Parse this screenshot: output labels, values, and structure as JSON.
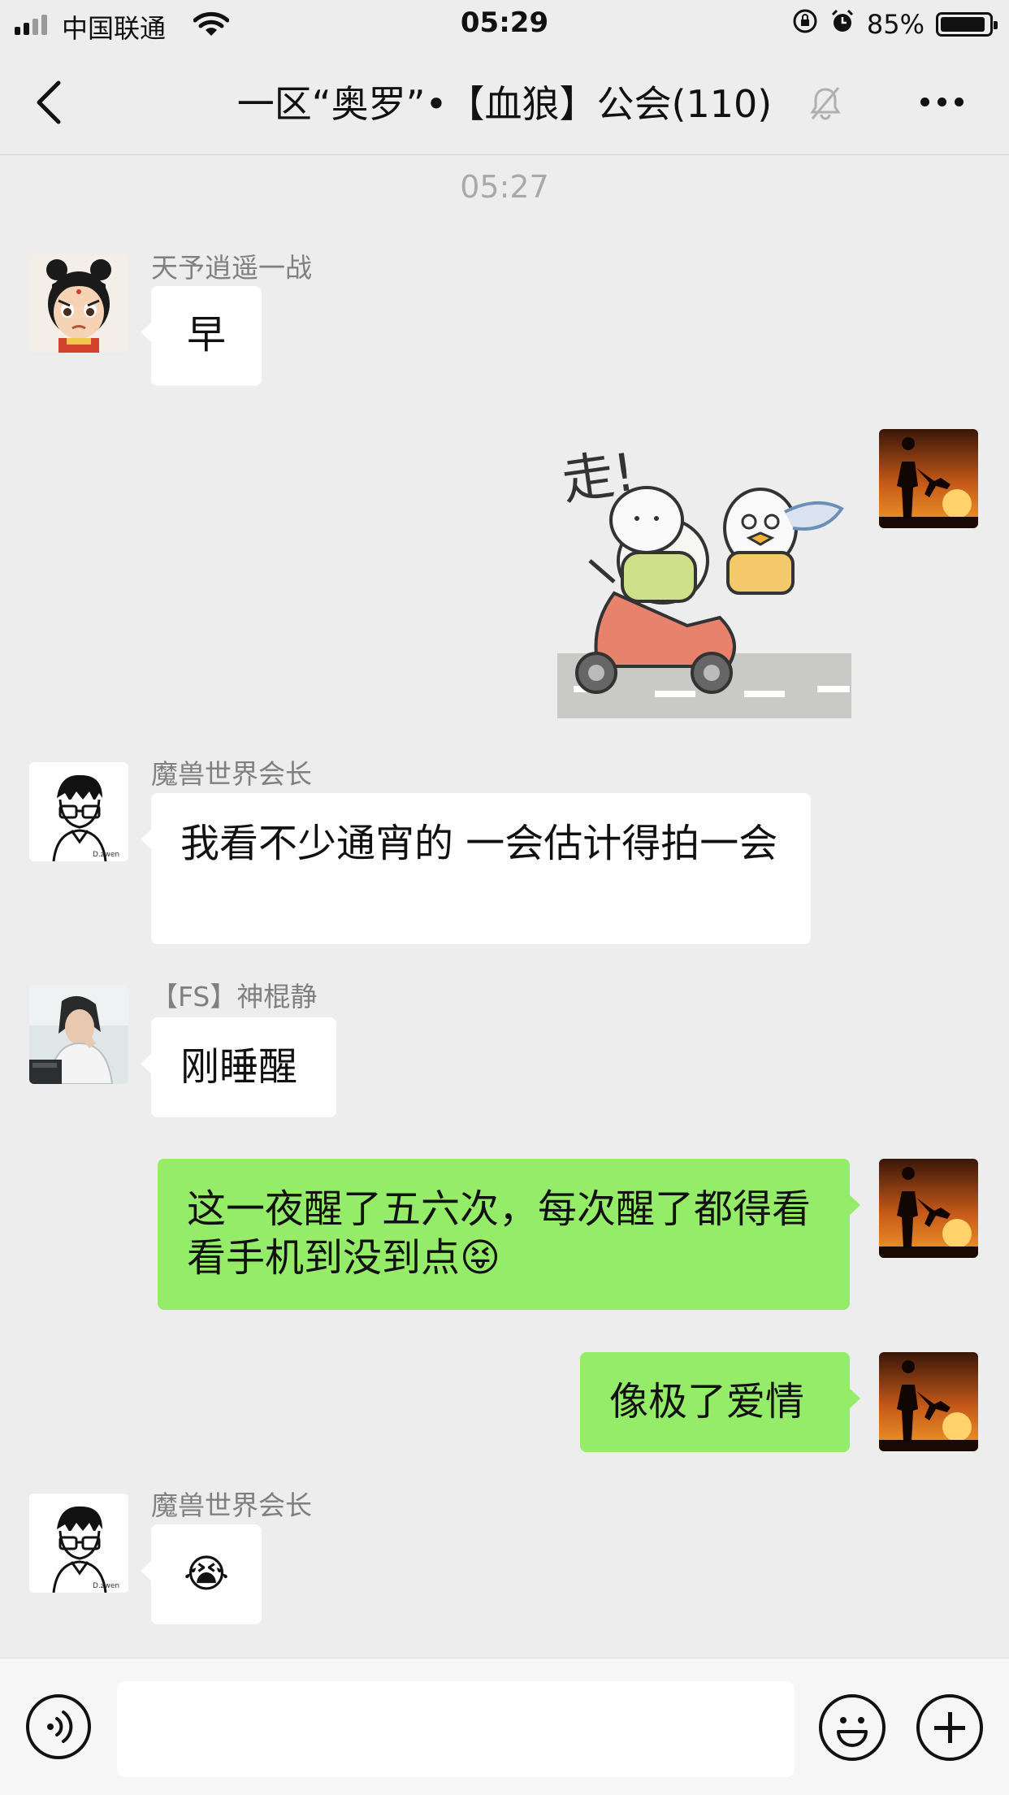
{
  "status_bar": {
    "carrier": "中国联通",
    "time": "05:29",
    "battery": "85%"
  },
  "header": {
    "title": "一区“奥罗”•【血狼】公会(110)"
  },
  "timestamp": "05:27",
  "messages": [
    {
      "side": "left",
      "sender": "天予逍遥一战",
      "text": "早"
    },
    {
      "side": "right",
      "type": "sticker",
      "text": "走!"
    },
    {
      "side": "left",
      "sender": "魔兽世界会长",
      "text": "我看不少通宵的 一会估计得拍一会"
    },
    {
      "side": "left",
      "sender": "【FS】神棍静",
      "text": "刚睡醒"
    },
    {
      "side": "right",
      "text": "这一夜醒了五六次，每次醒了都得看看手机到没到点😝"
    },
    {
      "side": "right",
      "text": "像极了爱情"
    },
    {
      "side": "left",
      "sender": "魔兽世界会长",
      "text": "😭"
    }
  ],
  "colors": {
    "background": "#ededed",
    "self_bubble": "#95ec69",
    "other_bubble": "#ffffff"
  }
}
